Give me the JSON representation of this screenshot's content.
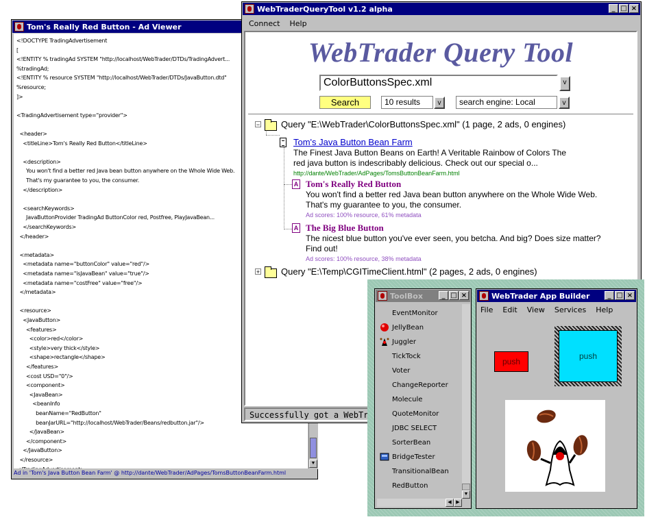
{
  "ad_viewer": {
    "title": "Tom's Really Red Button - Ad Viewer",
    "xml_lines": [
      "<!DOCTYPE TradingAdvertisement",
      "[",
      "<!ENTITY % tradingAd SYSTEM \"http://localhost/WebTrader/DTDs/TradingAdvert...",
      "%tradingAd;",
      "<!ENTITY % resource SYSTEM \"http://localhost/WebTrader/DTDs/JavaButton.dtd\"",
      "%resource;",
      "]>",
      "",
      "<TradingAdvertisement type=\"provider\">",
      "",
      "  <header>",
      "    <titleLine>Tom's Really Red Button</titleLine>",
      "",
      "    <description>",
      "      You won't find a better red Java bean button anywhere on the Whole Wide Web.",
      "      That's my guarantee to you, the consumer.",
      "    </description>",
      "",
      "    <searchKeywords>",
      "      JavaButtonProvider TradingAd ButtonColor red, Postfree, PlayJavaBean...",
      "    </searchKeywords>",
      "  </header>",
      "",
      "  <metadata>",
      "    <metadata name=\"buttonColor\" value=\"red\"/>",
      "    <metadata name=\"isJavaBean\" value=\"true\"/>",
      "    <metadata name=\"costFree\" value=\"free\"/>",
      "  </metadata>",
      "",
      "  <resource>",
      "    <JavaButton>",
      "      <features>",
      "        <color>red</color>",
      "        <style>very thick</style>",
      "        <shape>rectangle</shape>",
      "      </features>",
      "      <cost USD=\"0\"/>",
      "      <component>",
      "        <JavaBean>",
      "          <beanInfo",
      "            beanName=\"RedButton\"",
      "            beanJarURL=\"http://localhost/WebTrader/Beans/redbutton.jar\"/>",
      "        </JavaBean>",
      "      </component>",
      "    </JavaButton>",
      "  </resource>",
      "</TradingAdvertisement>"
    ],
    "status": "Ad in 'Tom's Java Button Bean Farm' @ http://dante/WebTrader/AdPages/TomsButtonBeanFarm.html"
  },
  "query_tool": {
    "title": "WebTraderQueryTool v1.2 alpha",
    "menu": [
      "Connect",
      "Help"
    ],
    "heading": "WebTrader Query Tool",
    "query_value": "ColorButtonsSpec.xml",
    "search_label": "Search",
    "results_value": "10 results",
    "engine_value": "search engine: Local",
    "dropdown_arrow": "v",
    "expander_minus": "−",
    "expander_plus": "+",
    "ad_icon_glyph": "A",
    "tree": {
      "query1": "Query \"E:\\WebTrader\\ColorButtonsSpec.xml\" (1 page, 2 ads, 0 engines)",
      "page_title": "Tom's Java Button Bean Farm",
      "page_desc": "The Finest Java Button Beans on Earth! A Veritable Rainbow of Colors The red java button is indescribably delicious. Check out our special o...",
      "page_url": "http://dante/WebTrader/AdPages/TomsButtonBeanFarm.html",
      "ads": [
        {
          "title": "Tom's Really Red Button",
          "desc": "You won't find a better red Java bean button anywhere on the Whole Wide Web. That's my guarantee to you, the consumer.",
          "score": "Ad scores: 100% resource, 61% metadata"
        },
        {
          "title": "The Big Blue Button",
          "desc": "The nicest blue button you've ever seen, you betcha. And big? Does size matter? Find out!",
          "score": "Ad scores: 100% resource, 38% metadata"
        }
      ],
      "query2": "Query \"E:\\Temp\\CGITimeClient.html\" (2 pages, 2 ads, 0 engines)"
    },
    "status": "Successfully got a WebTrader response"
  },
  "toolbox": {
    "title": "ToolBox",
    "items": [
      "EventMonitor",
      "JellyBean",
      "Juggler",
      "TickTock",
      "Voter",
      "ChangeReporter",
      "Molecule",
      "QuoteMonitor",
      "JDBC SELECT",
      "SorterBean",
      "BridgeTester",
      "TransitionalBean",
      "RedButton"
    ]
  },
  "builder": {
    "title": "WebTrader App Builder",
    "menu": [
      "File",
      "Edit",
      "View",
      "Services",
      "Help"
    ],
    "red_button_label": "push",
    "blue_button_label": "push"
  },
  "colors": {
    "active_title": "#000080",
    "heading": "#5a5aa0",
    "link": "#0000cc",
    "ad_title": "#800080",
    "url": "#008000",
    "score": "#9050c0",
    "red_button": "#ff0000",
    "blue_button": "#00e0ff",
    "search_button": "#ffff80"
  }
}
